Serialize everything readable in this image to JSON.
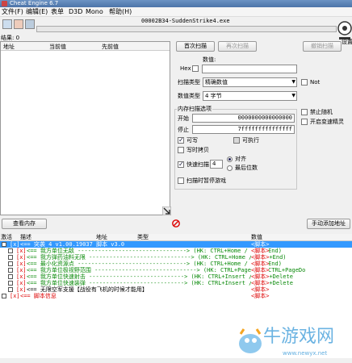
{
  "window": {
    "title": "Cheat Engine 6.7"
  },
  "menu": [
    "文件(F)",
    "编辑(E)",
    "表单",
    "D3D",
    "Mono",
    "帮助(H)"
  ],
  "process": {
    "label": "00002B34-SuddenStrike4.exe"
  },
  "found": {
    "label": "结果: 0"
  },
  "list_headers": {
    "address": "地址",
    "current": "当前值",
    "previous": "先前值"
  },
  "scan": {
    "first_scan": "首次扫描",
    "next_scan": "再次扫描",
    "undo_scan": "撤销扫描",
    "value_label": "数值:",
    "hex_label": "Hex",
    "scan_type_label": "扫描类型",
    "scan_type_value": "精确数值",
    "not_label": "Not",
    "value_type_label": "数值类型",
    "value_type_value": "4 字节",
    "mem_options_label": "内存扫描选项",
    "start_label": "开始",
    "start_value": "0000000000000000",
    "stop_label": "停止",
    "stop_value": "7fffffffffffffff",
    "writable": "可写",
    "executable": "可执行",
    "copy_on_write": "写时拷贝",
    "fast_scan": "快速扫描",
    "fast_scan_value": "4",
    "align": "对齐",
    "last_digits": "最后位数",
    "pause_game": "扫描时暂停游戏",
    "disable_random": "禁止随机",
    "speedhack": "开启变速精灵"
  },
  "settings_label": "设置",
  "memory_view_button": "查看内存",
  "add_address_button": "手动添加地址",
  "table_headers": {
    "active": "激活",
    "description": "描述",
    "address": "地址",
    "type": "类型",
    "value": "数值"
  },
  "table_rows": [
    {
      "check": "[x]",
      "desc": "<== 突袭 4 v1.00.19037 脚本 v3.0",
      "value": "<脚本>",
      "style": "sel",
      "indent": 0
    },
    {
      "check": "[x]",
      "desc": "<== 我方单位无敌  --------------------------------> (HK: CTRL+Home / CTRL+End)",
      "value": "<脚本>",
      "style": "green",
      "indent": 1
    },
    {
      "check": "[x]",
      "desc": "<== 我方弹药油料无限  ------------------------------> (HK: CTRL+Home / CTRL+End)",
      "value": "<脚本>",
      "style": "green",
      "indent": 1
    },
    {
      "check": "[x]",
      "desc": "<== 最小化资源点  --------------------------------> (HK: CTRL+Home / CTRL+End)",
      "value": "<脚本>",
      "style": "green",
      "indent": 1
    },
    {
      "check": "[x]",
      "desc": "<== 我方单位极视野范围  ------------------------------> (HK: CTRL+PageUp / CTRL+PageDo",
      "value": "<脚本>",
      "style": "green",
      "indent": 1
    },
    {
      "check": "[x]",
      "desc": "<== 我方单位快速射击  ----------------------------> (HK: CTRL+Insert / CTRL+Delete",
      "value": "<脚本>",
      "style": "green",
      "indent": 1
    },
    {
      "check": "[x]",
      "desc": "<== 我方单位快速装弹  ----------------------------> (HK: CTRL+Insert / CTRL+Delete",
      "value": "<脚本>",
      "style": "green",
      "indent": 1
    },
    {
      "check": "[x]",
      "desc": "<== 无限空军支援【战役有飞机的时候才能用】",
      "value": "<脚本>",
      "style": "black",
      "indent": 1
    },
    {
      "check": "[x]",
      "desc": "<== 脚本信息",
      "value": "<脚本>",
      "style": "red",
      "indent": 0
    }
  ],
  "watermark": {
    "text": "牛游戏网",
    "url": "www.newyx.net"
  }
}
